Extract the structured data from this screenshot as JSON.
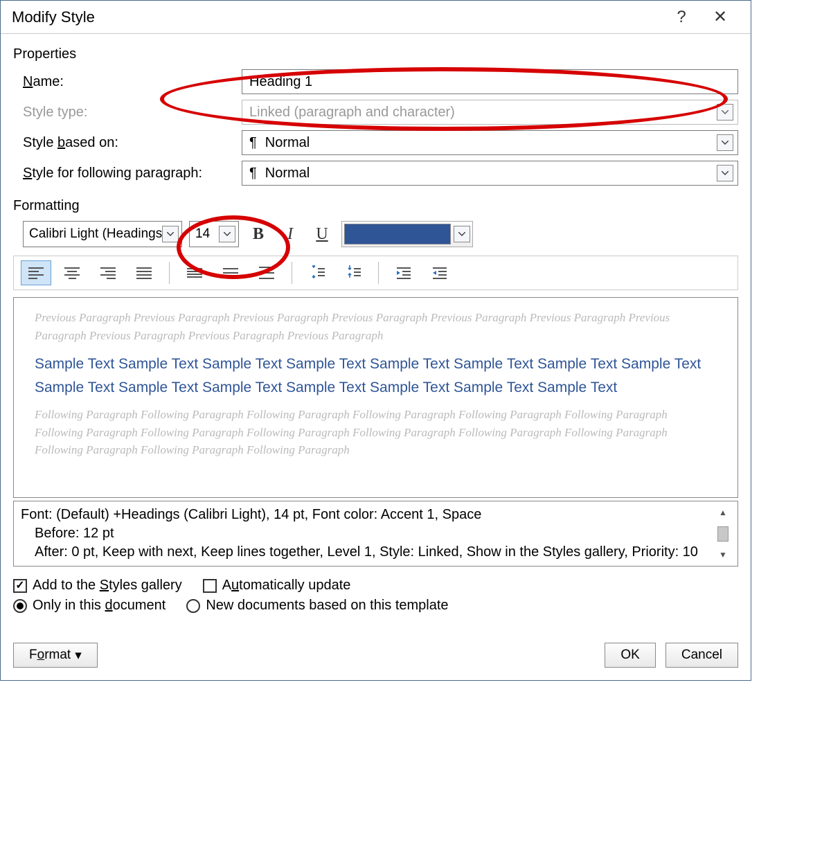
{
  "titlebar": {
    "title": "Modify Style",
    "help_glyph": "?",
    "close_glyph": "✕"
  },
  "properties": {
    "section_label": "Properties",
    "name_label_pre": "",
    "name_label_key": "N",
    "name_label_post": "ame:",
    "name_value": "Heading 1",
    "type_label": "Style type:",
    "type_value": "Linked (paragraph and character)",
    "based_on_label_pre": "Style ",
    "based_on_label_key": "b",
    "based_on_label_post": "ased on:",
    "based_on_value": "Normal",
    "following_label_pre": "",
    "following_label_key": "S",
    "following_label_post": "tyle for following paragraph:",
    "following_value": "Normal"
  },
  "formatting": {
    "section_label": "Formatting",
    "font_name": "Calibri Light (Headings)",
    "font_size": "14",
    "bold": "B",
    "italic": "I",
    "underline": "U",
    "font_color": "#2f5597"
  },
  "preview": {
    "previous": "Previous Paragraph Previous Paragraph Previous Paragraph Previous Paragraph Previous Paragraph Previous Paragraph Previous Paragraph Previous Paragraph Previous Paragraph Previous Paragraph",
    "sample": "Sample Text Sample Text Sample Text Sample Text Sample Text Sample Text Sample Text Sample Text Sample Text Sample Text Sample Text Sample Text Sample Text Sample Text Sample Text",
    "following": "Following Paragraph Following Paragraph Following Paragraph Following Paragraph Following Paragraph Following Paragraph Following Paragraph Following Paragraph Following Paragraph Following Paragraph Following Paragraph Following Paragraph Following Paragraph Following Paragraph Following Paragraph"
  },
  "description": {
    "line1": "Font: (Default) +Headings (Calibri Light), 14 pt, Font color: Accent 1, Space",
    "line2": "Before:  12 pt",
    "line3": "After:  0 pt, Keep with next, Keep lines together, Level 1, Style: Linked, Show in the Styles gallery, Priority: 10"
  },
  "options": {
    "add_gallery_pre": "Add to the ",
    "add_gallery_key": "S",
    "add_gallery_post": "tyles gallery",
    "auto_update_pre": "A",
    "auto_update_key": "u",
    "auto_update_post": "tomatically update",
    "only_doc_pre": "Only in this ",
    "only_doc_key": "d",
    "only_doc_post": "ocument",
    "new_docs": "New documents based on this template"
  },
  "buttons": {
    "format_pre": "F",
    "format_key": "o",
    "format_post": "rmat",
    "ok": "OK",
    "cancel": "Cancel"
  }
}
